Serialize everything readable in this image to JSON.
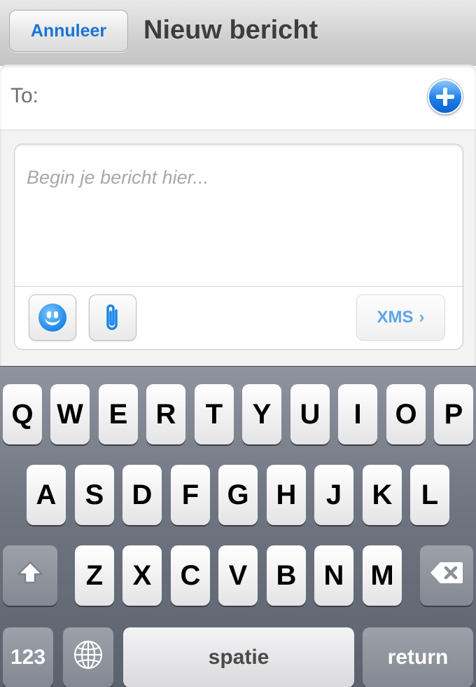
{
  "navbar": {
    "cancel_label": "Annuleer",
    "title": "Nieuw bericht"
  },
  "recipient": {
    "label": "To:",
    "add_icon": "plus-circle-icon"
  },
  "composer": {
    "placeholder": "Begin je bericht hier...",
    "emoji_icon": "smiley-icon",
    "attach_icon": "paperclip-icon",
    "send_label": "XMS",
    "send_chevron": "›"
  },
  "keyboard": {
    "row1": [
      "Q",
      "W",
      "E",
      "R",
      "T",
      "Y",
      "U",
      "I",
      "O",
      "P"
    ],
    "row2": [
      "A",
      "S",
      "D",
      "F",
      "G",
      "H",
      "J",
      "K",
      "L"
    ],
    "row3": [
      "Z",
      "X",
      "C",
      "V",
      "B",
      "N",
      "M"
    ],
    "numbers_label": "123",
    "space_label": "spatie",
    "return_label": "return",
    "shift_icon": "shift-icon",
    "backspace_icon": "backspace-icon",
    "globe_icon": "globe-icon"
  },
  "colors": {
    "accent": "#1a73d6",
    "add_button": "#1d7fe7",
    "keyboard_bg": "#6e7480"
  }
}
